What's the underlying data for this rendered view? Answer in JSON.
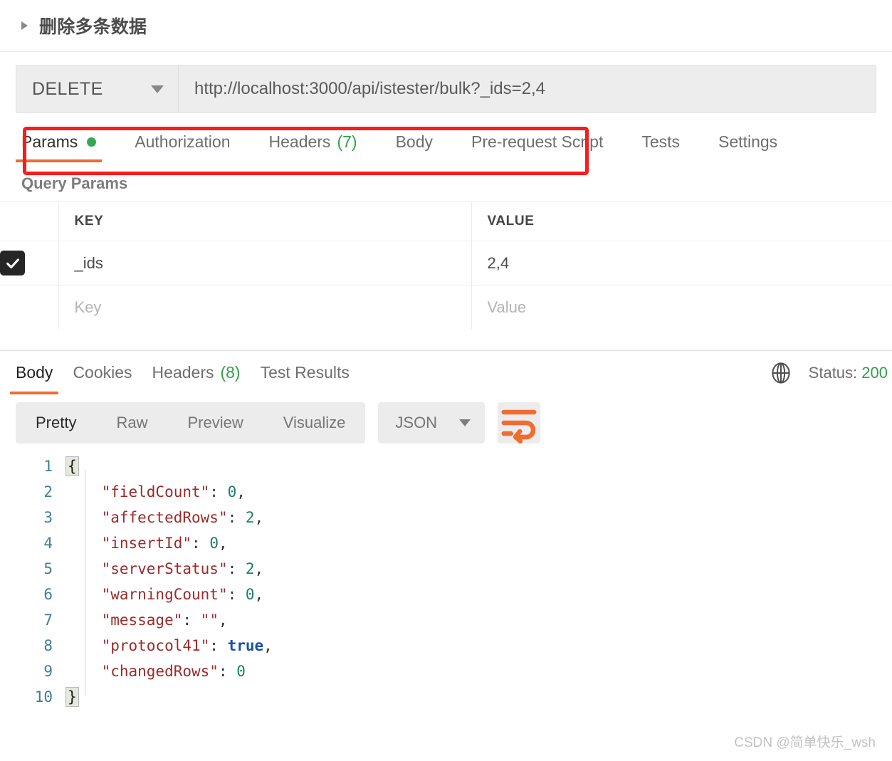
{
  "request": {
    "title": "删除多条数据",
    "disclosure_icon": "triangle-right-icon",
    "method": "DELETE",
    "method_caret_icon": "chevron-down-icon",
    "url": "http://localhost:3000/api/istester/bulk?_ids=2,4",
    "highlight_color": "#fb1b1b"
  },
  "request_tabs": [
    {
      "label": "Params",
      "badge": "",
      "dot": true,
      "active": true
    },
    {
      "label": "Authorization",
      "badge": "",
      "dot": false,
      "active": false
    },
    {
      "label": "Headers",
      "badge": "(7)",
      "dot": false,
      "active": false
    },
    {
      "label": "Body",
      "badge": "",
      "dot": false,
      "active": false
    },
    {
      "label": "Pre-request Script",
      "badge": "",
      "dot": false,
      "active": false
    },
    {
      "label": "Tests",
      "badge": "",
      "dot": false,
      "active": false
    },
    {
      "label": "Settings",
      "badge": "",
      "dot": false,
      "active": false
    }
  ],
  "query_params": {
    "section_label": "Query Params",
    "columns": [
      "KEY",
      "VALUE"
    ],
    "rows": [
      {
        "checked": true,
        "key": "_ids",
        "value": "2,4"
      }
    ],
    "placeholder_row": {
      "key": "Key",
      "value": "Value"
    }
  },
  "response_tabs": [
    {
      "label": "Body",
      "badge": "",
      "active": true
    },
    {
      "label": "Cookies",
      "badge": "",
      "active": false
    },
    {
      "label": "Headers",
      "badge": "(8)",
      "active": false
    },
    {
      "label": "Test Results",
      "badge": "",
      "active": false
    }
  ],
  "response_status": {
    "globe_icon": "globe-icon",
    "label": "Status:",
    "code": "200",
    "code_color": "#2fa14b"
  },
  "format_toolbar": {
    "views": [
      {
        "label": "Pretty",
        "active": true
      },
      {
        "label": "Raw",
        "active": false
      },
      {
        "label": "Preview",
        "active": false
      },
      {
        "label": "Visualize",
        "active": false
      }
    ],
    "language": "JSON",
    "language_caret_icon": "chevron-down-icon",
    "wrap_icon": "wrap-text-icon",
    "wrap_icon_color": "#ef6c33"
  },
  "response_body": {
    "language": "json",
    "line_numbers": [
      "1",
      "2",
      "3",
      "4",
      "5",
      "6",
      "7",
      "8",
      "9",
      "10"
    ],
    "lines": [
      {
        "n": "1",
        "tokens": [
          {
            "t": "{",
            "c": "tok-brace"
          }
        ]
      },
      {
        "n": "2",
        "tokens": [
          {
            "t": "    ",
            "c": "tok-punc"
          },
          {
            "t": "\"fieldCount\"",
            "c": "tok-key"
          },
          {
            "t": ": ",
            "c": "tok-punc"
          },
          {
            "t": "0",
            "c": "tok-num"
          },
          {
            "t": ",",
            "c": "tok-punc"
          }
        ]
      },
      {
        "n": "3",
        "tokens": [
          {
            "t": "    ",
            "c": "tok-punc"
          },
          {
            "t": "\"affectedRows\"",
            "c": "tok-key"
          },
          {
            "t": ": ",
            "c": "tok-punc"
          },
          {
            "t": "2",
            "c": "tok-num"
          },
          {
            "t": ",",
            "c": "tok-punc"
          }
        ]
      },
      {
        "n": "4",
        "tokens": [
          {
            "t": "    ",
            "c": "tok-punc"
          },
          {
            "t": "\"insertId\"",
            "c": "tok-key"
          },
          {
            "t": ": ",
            "c": "tok-punc"
          },
          {
            "t": "0",
            "c": "tok-num"
          },
          {
            "t": ",",
            "c": "tok-punc"
          }
        ]
      },
      {
        "n": "5",
        "tokens": [
          {
            "t": "    ",
            "c": "tok-punc"
          },
          {
            "t": "\"serverStatus\"",
            "c": "tok-key"
          },
          {
            "t": ": ",
            "c": "tok-punc"
          },
          {
            "t": "2",
            "c": "tok-num"
          },
          {
            "t": ",",
            "c": "tok-punc"
          }
        ]
      },
      {
        "n": "6",
        "tokens": [
          {
            "t": "    ",
            "c": "tok-punc"
          },
          {
            "t": "\"warningCount\"",
            "c": "tok-key"
          },
          {
            "t": ": ",
            "c": "tok-punc"
          },
          {
            "t": "0",
            "c": "tok-num"
          },
          {
            "t": ",",
            "c": "tok-punc"
          }
        ]
      },
      {
        "n": "7",
        "tokens": [
          {
            "t": "    ",
            "c": "tok-punc"
          },
          {
            "t": "\"message\"",
            "c": "tok-key"
          },
          {
            "t": ": ",
            "c": "tok-punc"
          },
          {
            "t": "\"\"",
            "c": "tok-str"
          },
          {
            "t": ",",
            "c": "tok-punc"
          }
        ]
      },
      {
        "n": "8",
        "tokens": [
          {
            "t": "    ",
            "c": "tok-punc"
          },
          {
            "t": "\"protocol41\"",
            "c": "tok-key"
          },
          {
            "t": ": ",
            "c": "tok-punc"
          },
          {
            "t": "true",
            "c": "tok-bool"
          },
          {
            "t": ",",
            "c": "tok-punc"
          }
        ]
      },
      {
        "n": "9",
        "tokens": [
          {
            "t": "    ",
            "c": "tok-punc"
          },
          {
            "t": "\"changedRows\"",
            "c": "tok-key"
          },
          {
            "t": ": ",
            "c": "tok-punc"
          },
          {
            "t": "0",
            "c": "tok-num"
          }
        ]
      },
      {
        "n": "10",
        "tokens": [
          {
            "t": "}",
            "c": "tok-brace"
          }
        ]
      }
    ],
    "parsed": {
      "fieldCount": 0,
      "affectedRows": 2,
      "insertId": 0,
      "serverStatus": 2,
      "warningCount": 0,
      "message": "",
      "protocol41": true,
      "changedRows": 0
    }
  },
  "watermark": "CSDN @简单快乐_wsh"
}
